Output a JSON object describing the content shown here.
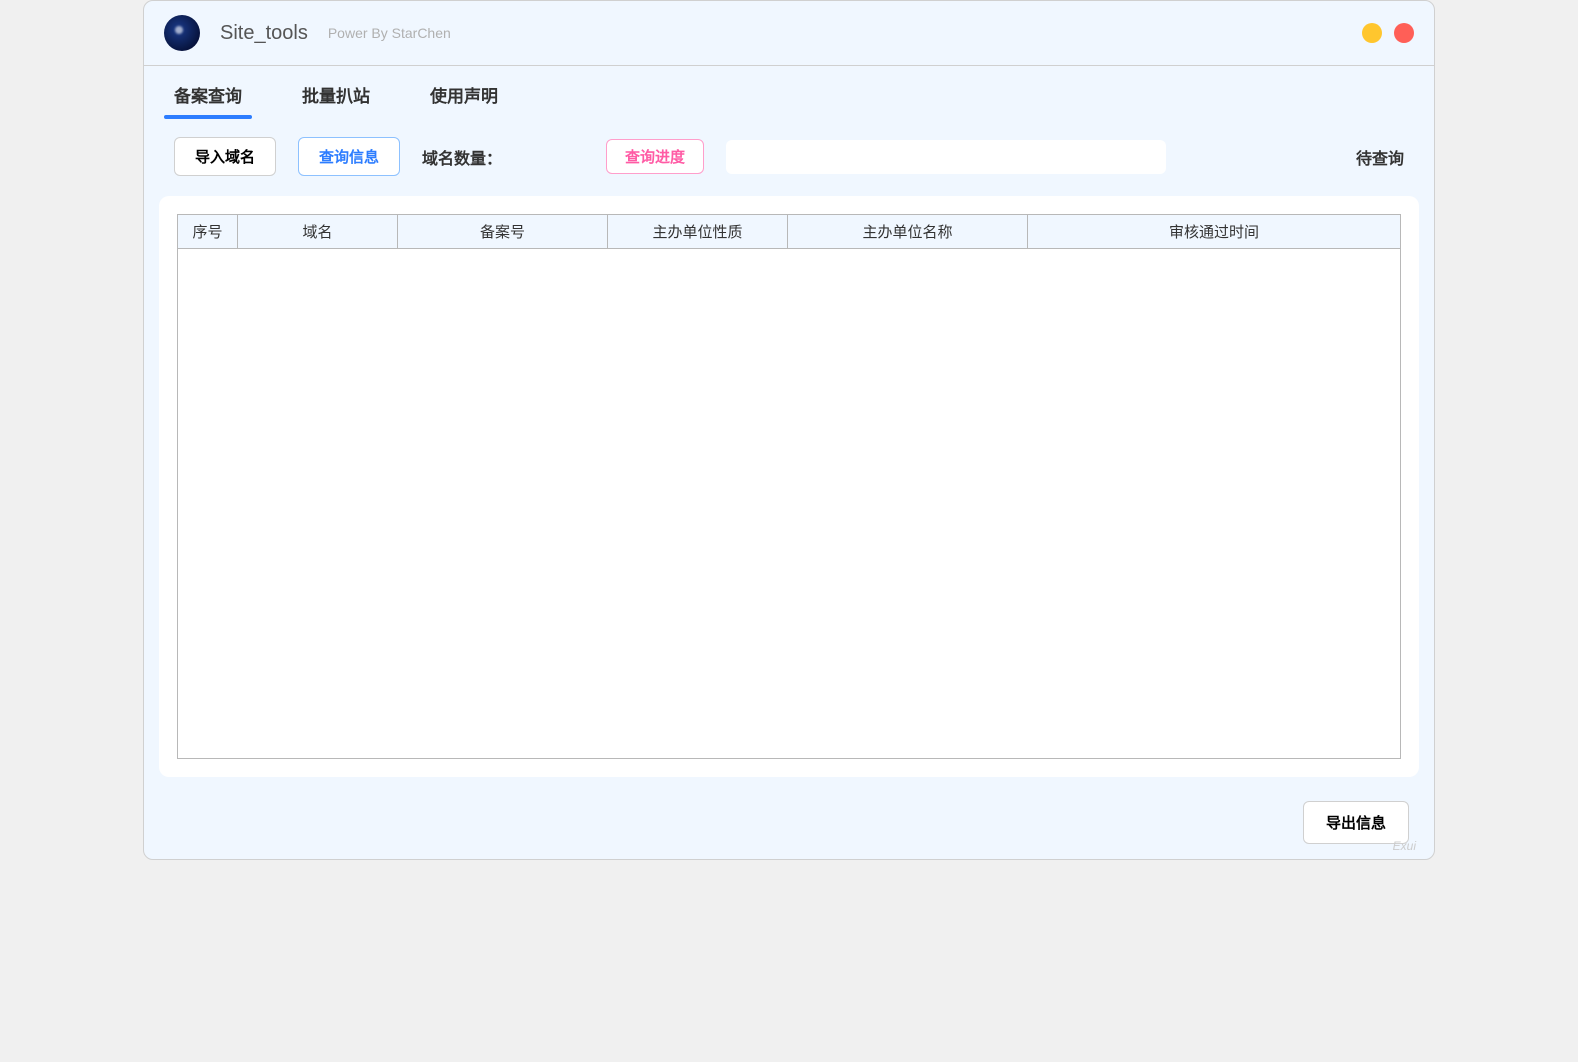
{
  "header": {
    "title": "Site_tools",
    "subtitle": "Power By StarChen"
  },
  "tabs": [
    {
      "label": "备案查询",
      "active": true
    },
    {
      "label": "批量扒站",
      "active": false
    },
    {
      "label": "使用声明",
      "active": false
    }
  ],
  "toolbar": {
    "import_button": "导入域名",
    "query_button": "查询信息",
    "domain_count_label": "域名数量：",
    "domain_count_value": "",
    "progress_label": "查询进度",
    "status_text": "待查询"
  },
  "table": {
    "columns": [
      "序号",
      "域名",
      "备案号",
      "主办单位性质",
      "主办单位名称",
      "审核通过时间"
    ],
    "rows": []
  },
  "bottom": {
    "export_button": "导出信息"
  },
  "watermark": "Exui"
}
